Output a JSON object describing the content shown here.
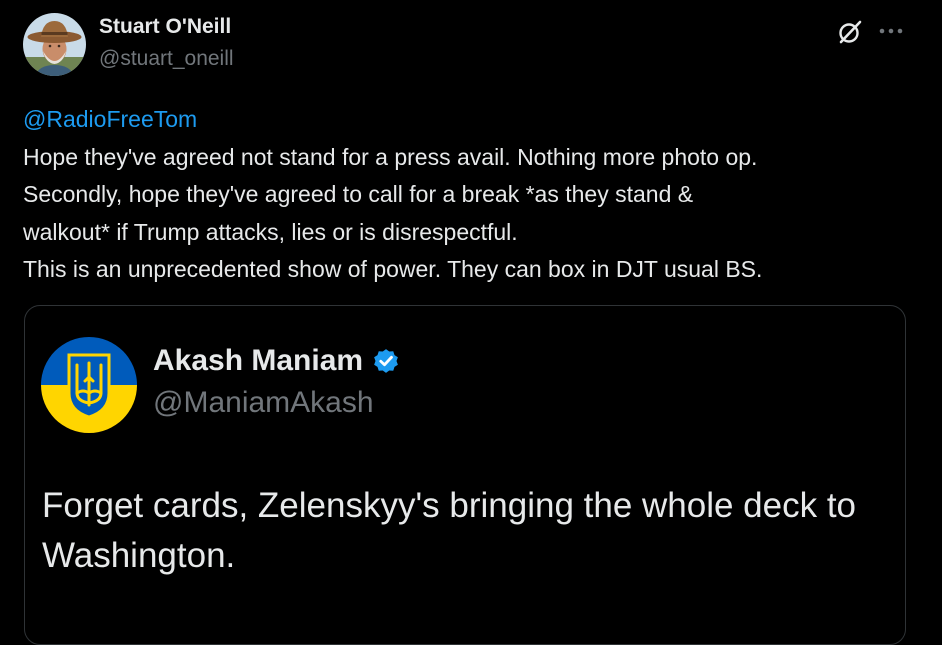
{
  "post": {
    "author": {
      "name": "Stuart O'Neill",
      "handle": "@stuart_oneill",
      "avatar_icon": "cowboy-hat-man-avatar"
    },
    "header_icons": [
      "grok-icon",
      "more-horizontal-icon"
    ],
    "mention": "@RadioFreeTom",
    "lines": [
      "Hope they've agreed not stand for a press avail. Nothing  more photo op.",
      "Secondly, hope they've agreed to call for a break *as they stand &",
      "walkout* if Trump attacks, lies or is disrespectful.",
      "This is an unprecedented show of power. They can box in DJT usual BS."
    ]
  },
  "quoted_post": {
    "author": {
      "name": "Akash Maniam",
      "handle": "@ManiamAkash",
      "verified": true,
      "avatar_icon": "ukraine-coat-of-arms-avatar"
    },
    "text": "Forget cards, Zelenskyy's bringing the whole deck to Washington."
  },
  "colors": {
    "background": "#000000",
    "text": "#e7e9ea",
    "secondary_text": "#71767b",
    "link": "#1d9bf0",
    "border": "#2f3336",
    "ukraine_blue": "#005bbb",
    "ukraine_yellow": "#ffd500"
  }
}
